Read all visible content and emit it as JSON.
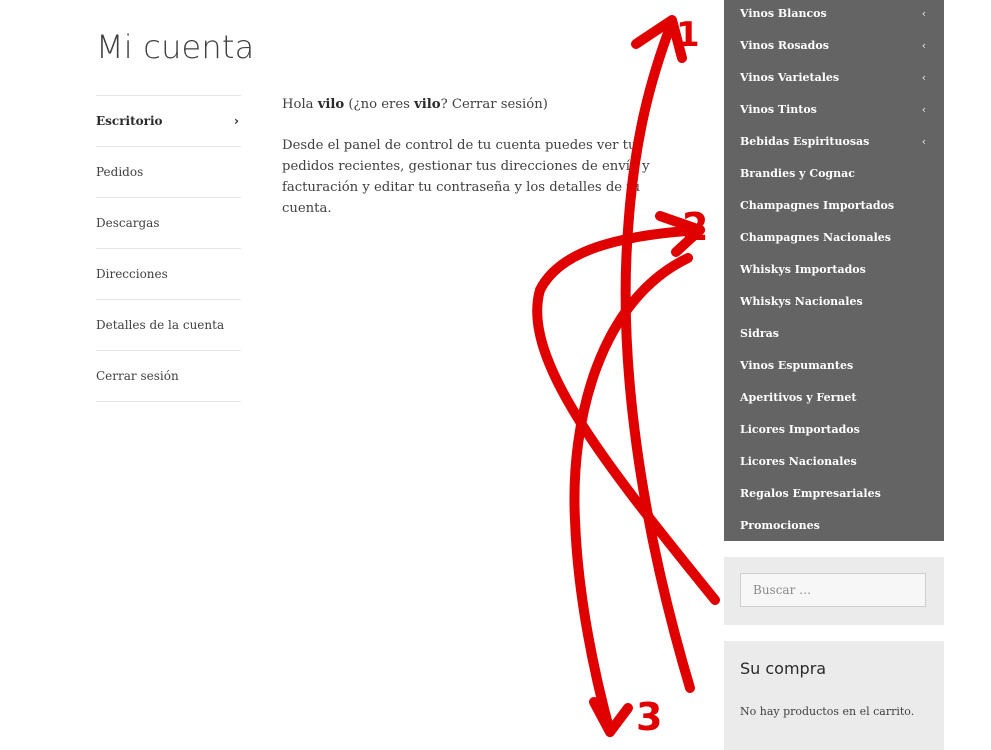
{
  "page": {
    "title": "Mi cuenta"
  },
  "account_nav": {
    "items": [
      {
        "label": "Escritorio",
        "active": true
      },
      {
        "label": "Pedidos"
      },
      {
        "label": "Descargas"
      },
      {
        "label": "Direcciones"
      },
      {
        "label": "Detalles de la cuenta"
      },
      {
        "label": "Cerrar sesión"
      }
    ],
    "active_chevron": "›"
  },
  "content": {
    "greeting_prefix": "Hola ",
    "username": "vilo",
    "greeting_middle": " (¿no eres ",
    "username_again": "vilo",
    "greeting_q": "? ",
    "logout_link": "Cerrar sesión",
    "greeting_suffix": ")",
    "dashboard_text": "Desde el panel de control de tu cuenta puedes ver tus pedidos recientes, gestionar tus direcciones de envío y facturación y editar tu contraseña y los detalles de tu cuenta."
  },
  "categories": {
    "arrow_glyph": "‹",
    "items": [
      {
        "label": "Vinos Blancos",
        "has_sub": true
      },
      {
        "label": "Vinos Rosados",
        "has_sub": true
      },
      {
        "label": "Vinos Varietales",
        "has_sub": true
      },
      {
        "label": "Vinos Tintos",
        "has_sub": true
      },
      {
        "label": "Bebidas Espirituosas",
        "has_sub": true
      },
      {
        "label": "Brandies y Cognac"
      },
      {
        "label": "Champagnes Importados"
      },
      {
        "label": "Champagnes Nacionales"
      },
      {
        "label": "Whiskys Importados"
      },
      {
        "label": "Whiskys Nacionales"
      },
      {
        "label": "Sidras"
      },
      {
        "label": "Vinos Espumantes"
      },
      {
        "label": "Aperitivos y Fernet"
      },
      {
        "label": "Licores Importados"
      },
      {
        "label": "Licores Nacionales"
      },
      {
        "label": "Regalos Empresariales"
      },
      {
        "label": "Promociones"
      }
    ]
  },
  "search": {
    "placeholder": "Buscar …"
  },
  "cart": {
    "title": "Su compra",
    "empty_text": "No hay productos en el carrito."
  },
  "annotations": {
    "color": "#e00000",
    "labels": [
      "1",
      "2",
      "3"
    ]
  }
}
